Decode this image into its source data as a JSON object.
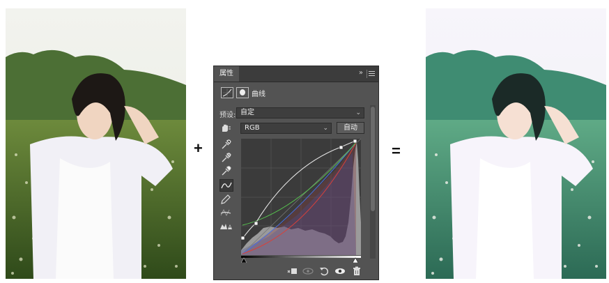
{
  "operators": {
    "plus": "+",
    "equals": "="
  },
  "panel": {
    "tab_label": "属性",
    "collapse_glyph": "»",
    "adjustment_title": "曲线",
    "preset_label": "预设:",
    "preset_value": "自定",
    "channel_value": "RGB",
    "auto_label": "自动"
  },
  "icons": {
    "panel": [
      "curves-adjustment-icon",
      "mask-icon",
      "hand-target-icon",
      "black-point-eyedropper-icon",
      "gray-point-eyedropper-icon",
      "white-point-eyedropper-icon",
      "curve-edit-icon",
      "pencil-icon",
      "smooth-icon",
      "clipping-warning-icon"
    ],
    "footer": [
      "clip-to-layer-icon",
      "view-previous-icon",
      "reset-icon",
      "visibility-icon",
      "trash-icon"
    ]
  },
  "colors": {
    "panel_bg": "#535353",
    "tab_bar_bg": "#3c3c3c",
    "graph_bg": "#3b3b3b",
    "histogram": "#9b9b9b",
    "curve_rgb": "#e6e6e6",
    "curve_red": "#d9403a",
    "curve_green": "#57c24f",
    "curve_blue": "#4a6ee0"
  }
}
